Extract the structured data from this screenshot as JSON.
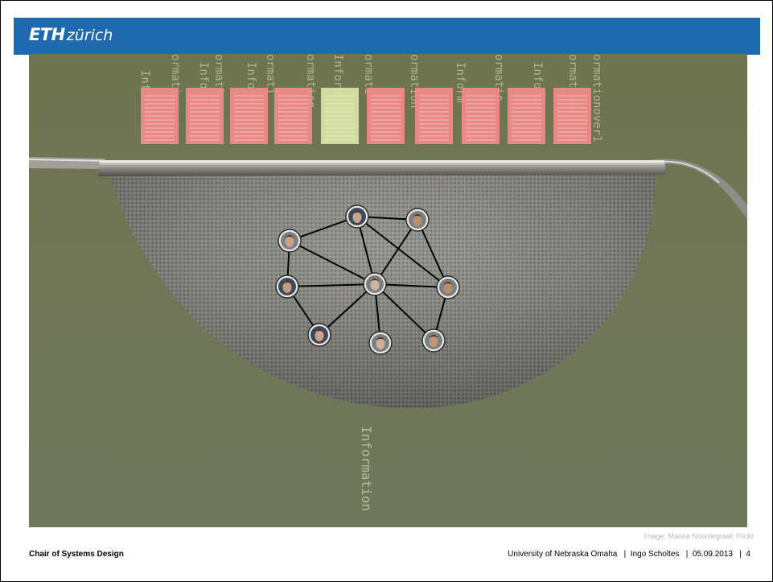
{
  "header": {
    "logo_bold": "ETH",
    "logo_light": "zürich",
    "brand_color": "#1f69b0"
  },
  "slide": {
    "bottom_label": "Information",
    "background_labels": [
      "ormation",
      "Inform",
      "ormati",
      "Inform",
      "ormati",
      "ormation",
      "Inform",
      "ormati",
      "ormation",
      "Inform",
      "ormatio",
      "Inform",
      "ormation",
      "ormationover1",
      "Information"
    ],
    "documents": [
      {
        "status": "rejected",
        "color": "#f28b8b"
      },
      {
        "status": "rejected",
        "color": "#f28b8b"
      },
      {
        "status": "rejected",
        "color": "#f28b8b"
      },
      {
        "status": "rejected",
        "color": "#f28b8b"
      },
      {
        "status": "accepted",
        "color": "#d9e6a6"
      },
      {
        "status": "rejected",
        "color": "#f28b8b"
      },
      {
        "status": "rejected",
        "color": "#f28b8b"
      },
      {
        "status": "rejected",
        "color": "#f28b8b"
      },
      {
        "status": "rejected",
        "color": "#f28b8b"
      },
      {
        "status": "rejected",
        "color": "#f28b8b"
      }
    ],
    "network_nodes": [
      "person-1",
      "person-2",
      "person-3",
      "person-4",
      "person-5",
      "person-6",
      "person-7",
      "person-8",
      "person-9"
    ],
    "image_credit": "Image: Marina Noordegraaf, Flickr"
  },
  "footer": {
    "left": "Chair of Systems Design",
    "right": "University of Nebraska Omaha   |  Ingo Scholtes   |  05.09.2013   |  4"
  }
}
